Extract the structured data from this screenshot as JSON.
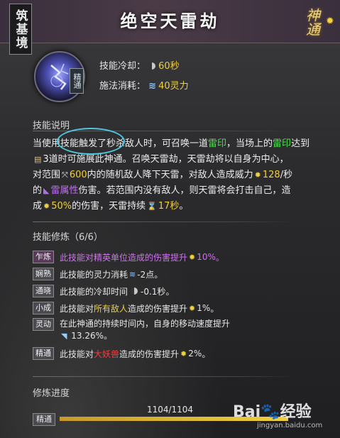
{
  "header": {
    "rank": "筑基境",
    "title": "绝空天雷劫",
    "category": "神通"
  },
  "skill": {
    "rank_badge": "精通",
    "cooldown_label": "技能冷却：",
    "cooldown_value": "60秒",
    "cost_label": "施法消耗：",
    "cost_value": "40灵力"
  },
  "description": {
    "title": "技能说明",
    "p1": "当使用技能触发了秒杀敌人时，可召唤一道",
    "p1_hl1": "雷印",
    "p1b": "，当场上的",
    "p1_hl2": "雷印",
    "p1c": "达到",
    "p2": "3道时可施展此神通。召唤天雷劫，天雷劫将以自身为中心，",
    "p3a": "对范围",
    "p3_val": "600",
    "p3b": "内的随机敌人降下天雷，对敌人造成威力",
    "p3_power": "128",
    "p3c": "/秒",
    "p4a": "的",
    "p4_hl": "雷属性",
    "p4b": "伤害。若范围内没有敌人，则天雷将会打击自己，造",
    "p5a": "成",
    "p5_pct": "50%",
    "p5b": "的伤害，天雷持续",
    "p5_dur": "17秒",
    "p5c": "。"
  },
  "training": {
    "title": "技能修炼（6/6）",
    "rows": [
      {
        "tag": "乍炼",
        "text_a": "此技能对精英单位造成的伤害提升",
        "value": "10%",
        "tail": "。"
      },
      {
        "tag": "娴熟",
        "text_a": "此技能的灵力消耗",
        "value": "-2点",
        "tail": "。"
      },
      {
        "tag": "通晓",
        "text_a": "此技能的冷却时间",
        "value": "-0.1秒",
        "tail": "。"
      },
      {
        "tag": "小成",
        "text_a": "此技能对",
        "hl": "所有敌人",
        "text_b": "造成的伤害提升",
        "value": "1%",
        "tail": "。"
      },
      {
        "tag": "灵动",
        "text_a": "在此神通的持续时间内，自身的移动速度提升",
        "value": "13.26%",
        "tail": "。"
      },
      {
        "tag": "精通",
        "text_a": "此技能对",
        "hl": "大妖兽",
        "text_b": "造成的伤害提升",
        "value": "2%",
        "tail": "。"
      }
    ]
  },
  "progress": {
    "title": "修炼进度",
    "value_text": "1104/1104",
    "fraction": 1.0,
    "tag": "精通"
  },
  "watermark": {
    "brand": "Bai",
    "brand2": "经验",
    "url": "jingyan.baidu.com"
  }
}
